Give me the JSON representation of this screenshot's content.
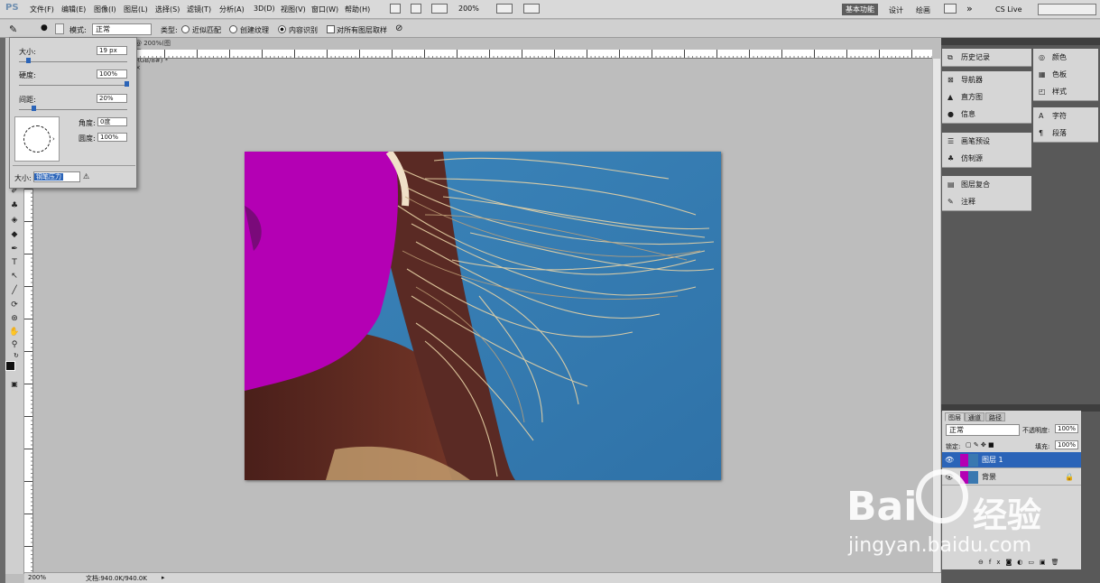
{
  "app": {
    "logo": "PS"
  },
  "menu": [
    "文件(F)",
    "编辑(E)",
    "图像(I)",
    "图层(L)",
    "选择(S)",
    "滤镜(T)",
    "分析(A)",
    "3D(D)",
    "视图(V)",
    "窗口(W)",
    "帮助(H)"
  ],
  "zoom_top": "200%",
  "workspaces": {
    "active": "基本功能",
    "others": [
      "设计",
      "绘画"
    ],
    "more": "»",
    "live": "CS Live"
  },
  "options": {
    "mode_label": "模式:",
    "mode_value": "正常",
    "type_label": "类型:",
    "radio1": "近似匹配",
    "radio2": "创建纹理",
    "radio3": "内容识别",
    "sample_all": "对所有图层取样"
  },
  "doc_tab": "@ 200%(图层 1, RGB/8#) *  ×",
  "brush_panel": {
    "size_label": "大小:",
    "size_value": "19 px",
    "size_fraction": 0.12,
    "hardness_label": "硬度:",
    "hardness_value": "100%",
    "hardness_fraction": 1.0,
    "spacing_label": "间距:",
    "spacing_value": "20%",
    "spacing_fraction": 0.2,
    "angle_label": "角度:",
    "angle_value": "0度",
    "roundness_label": "圆度:",
    "roundness_value": "100%",
    "pressure_label": "大小:",
    "pressure_value": "钢笔压力"
  },
  "status": {
    "zoom": "200%",
    "doc": "文档:940.0K/940.0K"
  },
  "dock": {
    "group1": [
      "历史记录"
    ],
    "group2": [
      "导航器",
      "直方图",
      "信息"
    ],
    "group3": [
      "画笔预设",
      "仿制源"
    ],
    "group4": [
      "图层复合",
      "注释"
    ],
    "side1": [
      "颜色",
      "色板",
      "样式"
    ],
    "side2": [
      "字符",
      "段落"
    ]
  },
  "layers_panel": {
    "tabs": [
      "图层",
      "通道",
      "路径"
    ],
    "blend": "正常",
    "opacity_label": "不透明度:",
    "opacity_value": "100%",
    "lock_label": "锁定:",
    "fill_label": "填充:",
    "fill_value": "100%",
    "layers": [
      {
        "name": "图层 1",
        "selected": true
      },
      {
        "name": "背景",
        "selected": false
      }
    ]
  },
  "watermark": {
    "brand": "Bai",
    "brand2": "经验",
    "url": "jingyan.baidu.com"
  },
  "colors": {
    "accent": "#2b64b8",
    "photo_bg": "#3a7fb3",
    "magenta": "#b400b4"
  }
}
